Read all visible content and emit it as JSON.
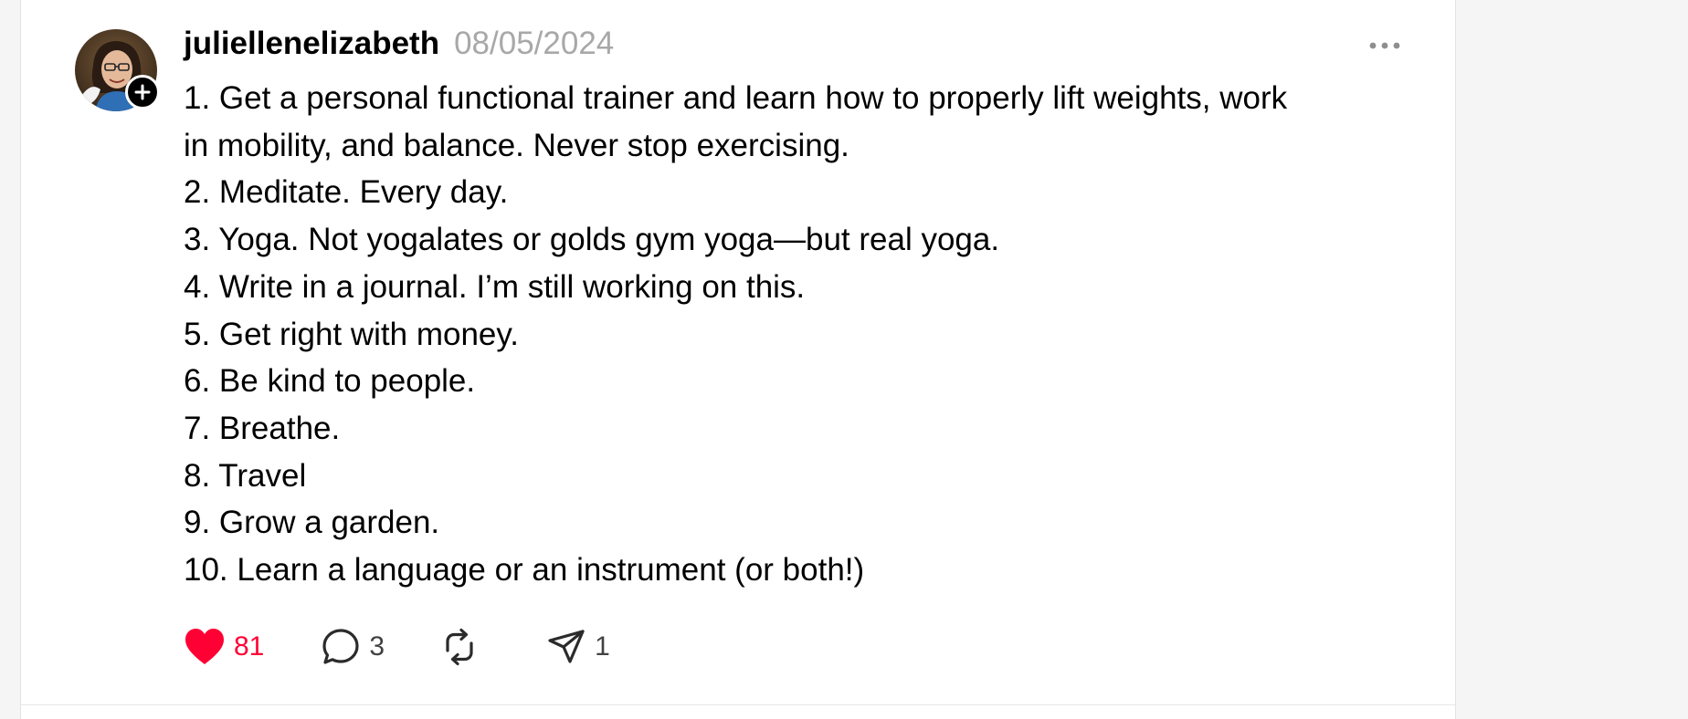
{
  "post": {
    "author": "juliellenelizabeth",
    "date": "08/05/2024",
    "lines": [
      "1. Get a personal functional trainer and learn how to properly lift weights, work",
      "in mobility, and balance. Never stop exercising.",
      "2. Meditate. Every day.",
      "3. Yoga. Not yogalates or golds gym yoga—but real yoga.",
      "4. Write in a journal. I’m still working on this.",
      "5. Get right with money.",
      "6. Be kind to people.",
      "7. Breathe.",
      "8. Travel",
      "9. Grow a garden.",
      "10. Learn a language or an instrument (or both!)"
    ]
  },
  "actions": {
    "likes": "81",
    "replies": "3",
    "reposts": "",
    "shares": "1"
  },
  "icons": {
    "like": "heart-filled-icon",
    "reply": "speech-bubble-icon",
    "repost": "repost-arrows-icon",
    "share": "paper-plane-icon",
    "more": "ellipsis-icon",
    "follow": "plus-icon"
  },
  "colors": {
    "like_active": "#ff0034",
    "date_gray": "#a8a8a8",
    "text": "#000000",
    "page_background": "#f5f5f5",
    "card_background": "#ffffff"
  }
}
